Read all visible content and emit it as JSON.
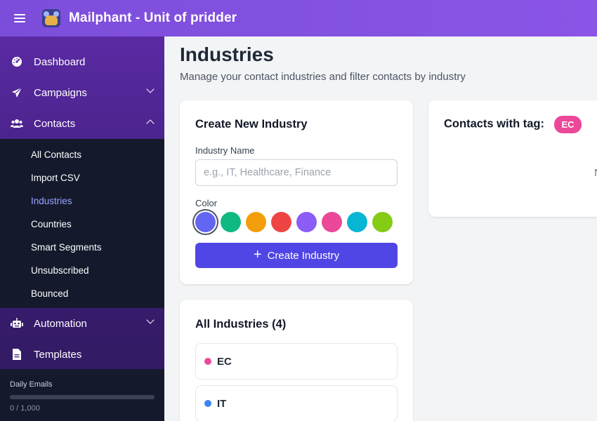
{
  "app": {
    "title": "Mailphant - Unit of pridder"
  },
  "sidebar": {
    "items": [
      {
        "label": "Dashboard"
      },
      {
        "label": "Campaigns"
      },
      {
        "label": "Contacts"
      },
      {
        "label": "Automation"
      },
      {
        "label": "Templates"
      }
    ],
    "contacts_submenu": [
      {
        "label": "All Contacts"
      },
      {
        "label": "Import CSV"
      },
      {
        "label": "Industries"
      },
      {
        "label": "Countries"
      },
      {
        "label": "Smart Segments"
      },
      {
        "label": "Unsubscribed"
      },
      {
        "label": "Bounced"
      }
    ],
    "active_subitem": "Industries",
    "footer": {
      "label": "Daily Emails",
      "count": "0 / 1,000",
      "progress": 0
    }
  },
  "page": {
    "title": "Industries",
    "subtitle": "Manage your contact industries and filter contacts by industry"
  },
  "create_card": {
    "title": "Create New Industry",
    "name_label": "Industry Name",
    "name_value": "",
    "name_placeholder": "e.g., IT, Healthcare, Finance",
    "color_label": "Color",
    "colors": [
      "#6366f1",
      "#10b981",
      "#f59e0b",
      "#ef4444",
      "#8b5cf6",
      "#ec4899",
      "#06b6d4",
      "#84cc16"
    ],
    "selected_color": "#6366f1",
    "button_label": "Create Industry"
  },
  "all_card": {
    "title": "All Industries (4)",
    "industries": [
      {
        "name": "EC",
        "color": "#ec4899"
      },
      {
        "name": "IT",
        "color": "#3b82f6"
      }
    ]
  },
  "tag_card": {
    "title": "Contacts with tag:",
    "tag": "EC",
    "tag_color": "#ec4899",
    "clipped_text": "N"
  }
}
